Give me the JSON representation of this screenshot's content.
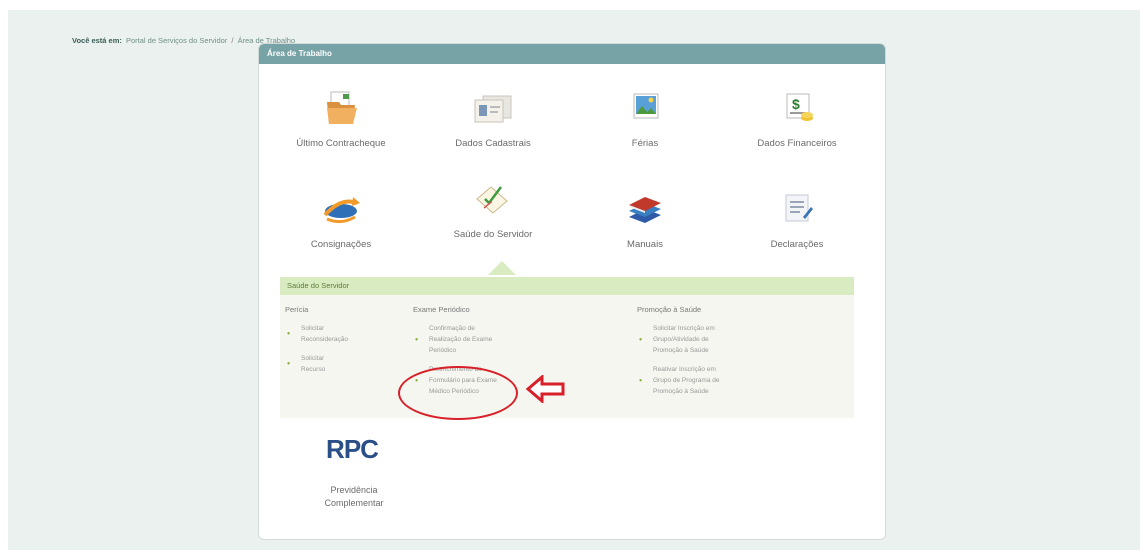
{
  "breadcrumb": {
    "lead": "Você está em:",
    "link": "Portal de Serviços do Servidor",
    "separator": "/",
    "current": "Área de Trabalho"
  },
  "panel": {
    "title": "Área de Trabalho"
  },
  "tiles": [
    {
      "label": "Último Contracheque",
      "icon": "folder-icon"
    },
    {
      "label": "Dados Cadastrais",
      "icon": "id-cards-icon"
    },
    {
      "label": "Férias",
      "icon": "vacation-photo-icon"
    },
    {
      "label": "Dados Financeiros",
      "icon": "money-icon"
    },
    {
      "label": "Consignações",
      "icon": "globe-arrow-icon"
    },
    {
      "label": "Saúde do Servidor",
      "icon": "checklist-icon"
    },
    {
      "label": "Manuais",
      "icon": "books-icon"
    },
    {
      "label": "Declarações",
      "icon": "document-pen-icon"
    }
  ],
  "submenu": {
    "title": "Saúde do Servidor",
    "columns": [
      {
        "title": "Perícia",
        "items": [
          [
            "Solicitar",
            "Reconsideração"
          ],
          [
            "Solicitar",
            "Recurso"
          ]
        ]
      },
      {
        "title": "Exame Periódico",
        "items": [
          [
            "Confirmação de",
            "Realização de Exame",
            "Periódico"
          ],
          [
            "Preenchimento do",
            "Formulário para Exame",
            "Médico Periódico"
          ]
        ]
      },
      {
        "title": "Promoção à Saúde",
        "items": [
          [
            "Solicitar Inscrição em",
            "Grupo/Atividade de",
            "Promoção à Saúde"
          ],
          [
            "Reativar Inscrição em",
            "Grupo de Programa de",
            "Promoção à Saúde"
          ]
        ]
      }
    ]
  },
  "rpc": {
    "title": "RPC",
    "label_line1": "Previdência",
    "label_line2": "Complementar"
  },
  "colors": {
    "header": "#78a3a6",
    "submenu_header": "#d9ebc1",
    "highlight": "#d8202a",
    "rpc": "#2a4f86"
  }
}
